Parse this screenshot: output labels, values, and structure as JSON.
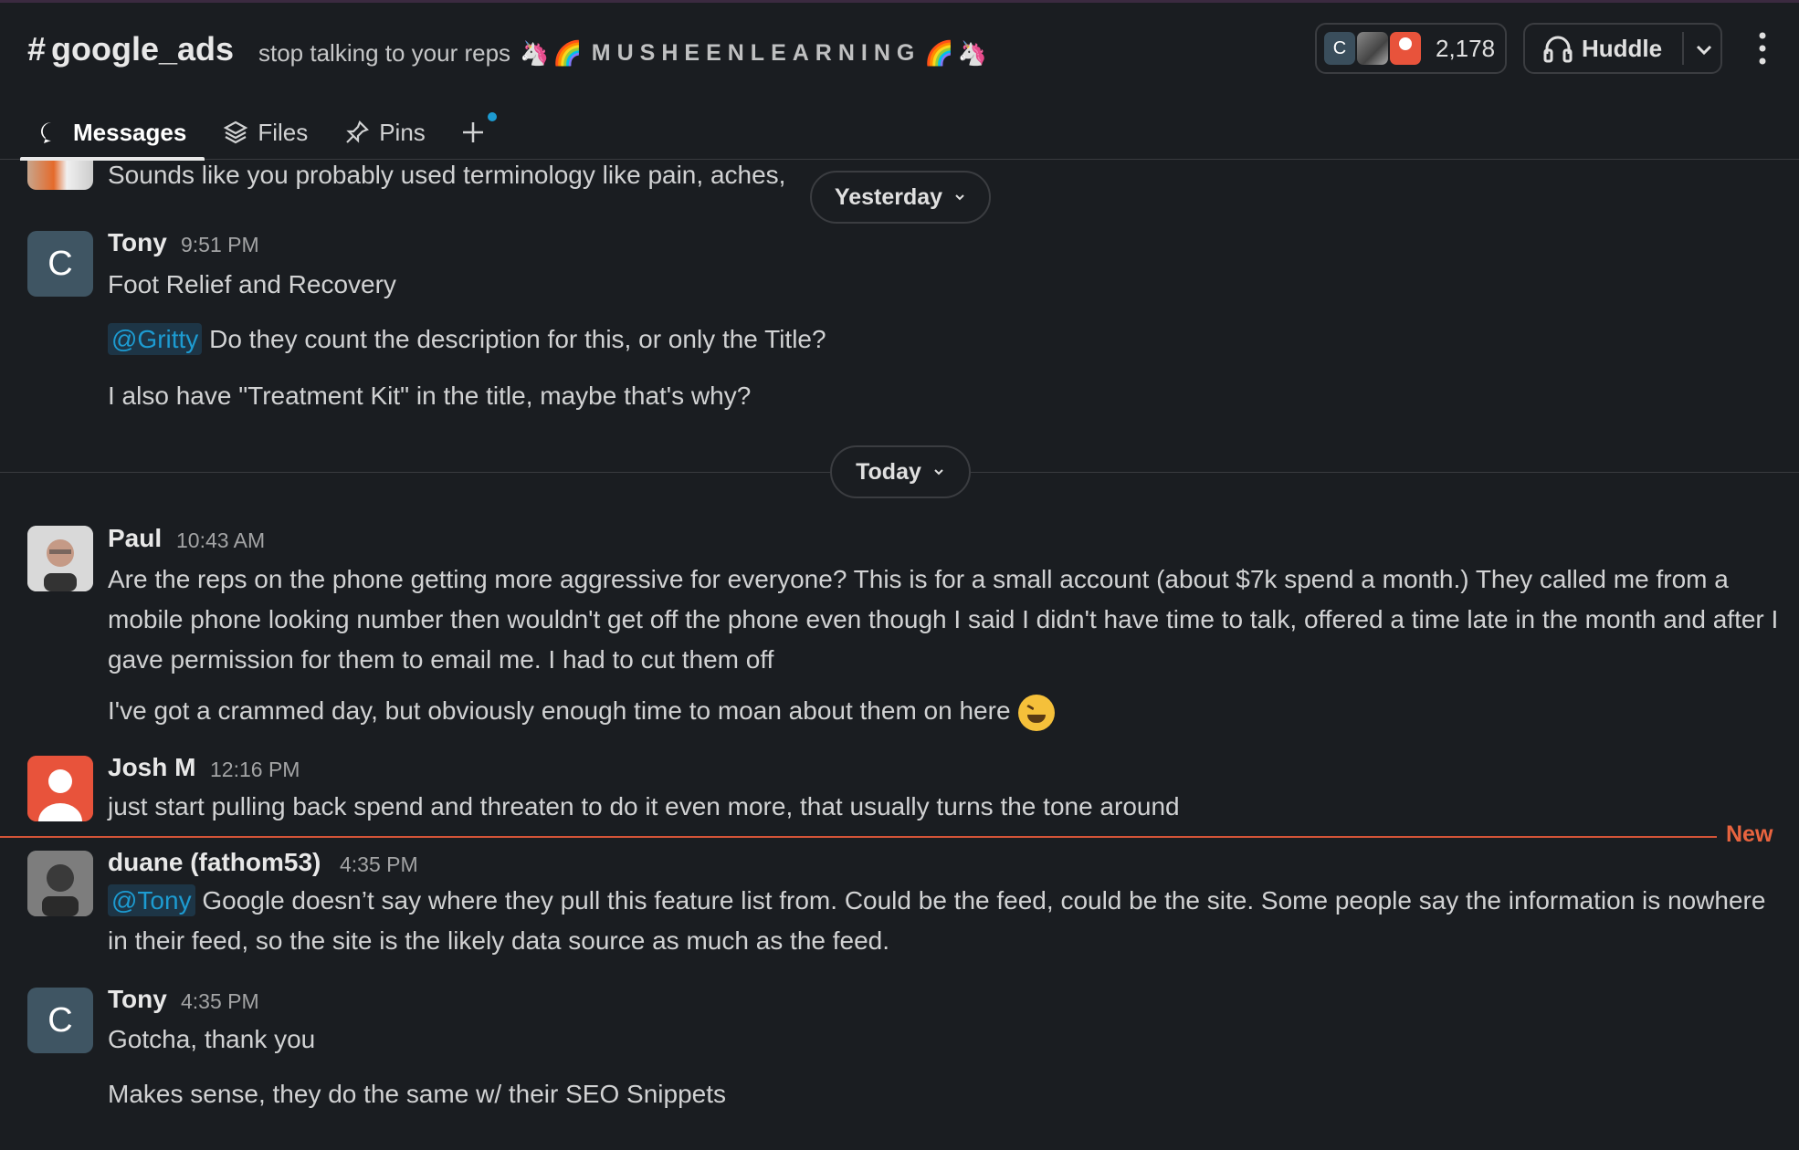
{
  "channel": {
    "name": "google_ads",
    "topic": "stop talking to your reps",
    "topic_decoration": "MUSHEENLEARNING",
    "member_count": "2,178",
    "member_avatar_letter": "C"
  },
  "header": {
    "huddle_label": "Huddle"
  },
  "tabs": [
    {
      "label": "Messages",
      "active": true
    },
    {
      "label": "Files"
    },
    {
      "label": "Pins"
    }
  ],
  "dividers": {
    "yesterday": "Yesterday",
    "today": "Today",
    "new_label": "New"
  },
  "messages": [
    {
      "author": "",
      "time": "",
      "lines": [
        "Sounds like you probably used terminology like pain, aches,"
      ]
    },
    {
      "author": "Tony",
      "avatar_letter": "C",
      "time": "9:51 PM",
      "lines": [
        "Foot Relief and Recovery",
        "Do they count the description for this, or only the Title?",
        "I also have \"Treatment Kit\" in the title, maybe that's why?"
      ],
      "mention": "@Gritty"
    },
    {
      "author": "Paul",
      "time": "10:43 AM",
      "lines": [
        "Are the reps on the phone getting more aggressive for everyone? This is for a small account (about $7k spend a month.) They called me from a mobile phone looking number then wouldn't get off the phone even though I said I didn't have time to talk, offered a time late in the month and after I gave permission for them to email me. I had to cut them off",
        "I've got a crammed day, but obviously enough time to moan about them on here"
      ]
    },
    {
      "author": "Josh M",
      "time": "12:16 PM",
      "lines": [
        "just start pulling back spend and threaten to do it even more, that usually turns the tone around"
      ]
    },
    {
      "author": "duane (fathom53)",
      "time": "4:35 PM",
      "mention": "@Tony",
      "lines": [
        "Google doesn’t say where they pull this feature list from. Could be the feed, could be the site. Some people say the information is nowhere in their feed, so the site is the likely data source as much as the feed."
      ]
    },
    {
      "author": "Tony",
      "avatar_letter": "C",
      "time": "4:35 PM",
      "lines": [
        "Gotcha, thank you",
        "Makes sense, they do the same w/ their SEO Snippets"
      ]
    }
  ]
}
